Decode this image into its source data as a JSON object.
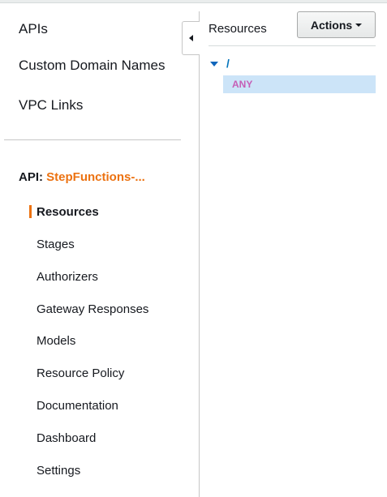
{
  "left_nav": {
    "links": [
      "APIs",
      "Custom Domain Names",
      "VPC Links"
    ],
    "api_label": "API:",
    "api_name": "StepFunctions-...",
    "items": [
      "Resources",
      "Stages",
      "Authorizers",
      "Gateway Responses",
      "Models",
      "Resource Policy",
      "Documentation",
      "Dashboard",
      "Settings"
    ],
    "active_item": "Resources"
  },
  "resources_panel": {
    "title": "Resources",
    "actions_label": "Actions",
    "tree": {
      "root": "/",
      "methods": [
        "ANY"
      ]
    }
  },
  "colors": {
    "accent": "#ec7211",
    "link": "#0073bb",
    "method": "#c65eb5",
    "selection": "#cce4f8"
  },
  "icons": [
    "collapse-left-icon",
    "chevron-down-icon",
    "tree-expand-icon"
  ]
}
